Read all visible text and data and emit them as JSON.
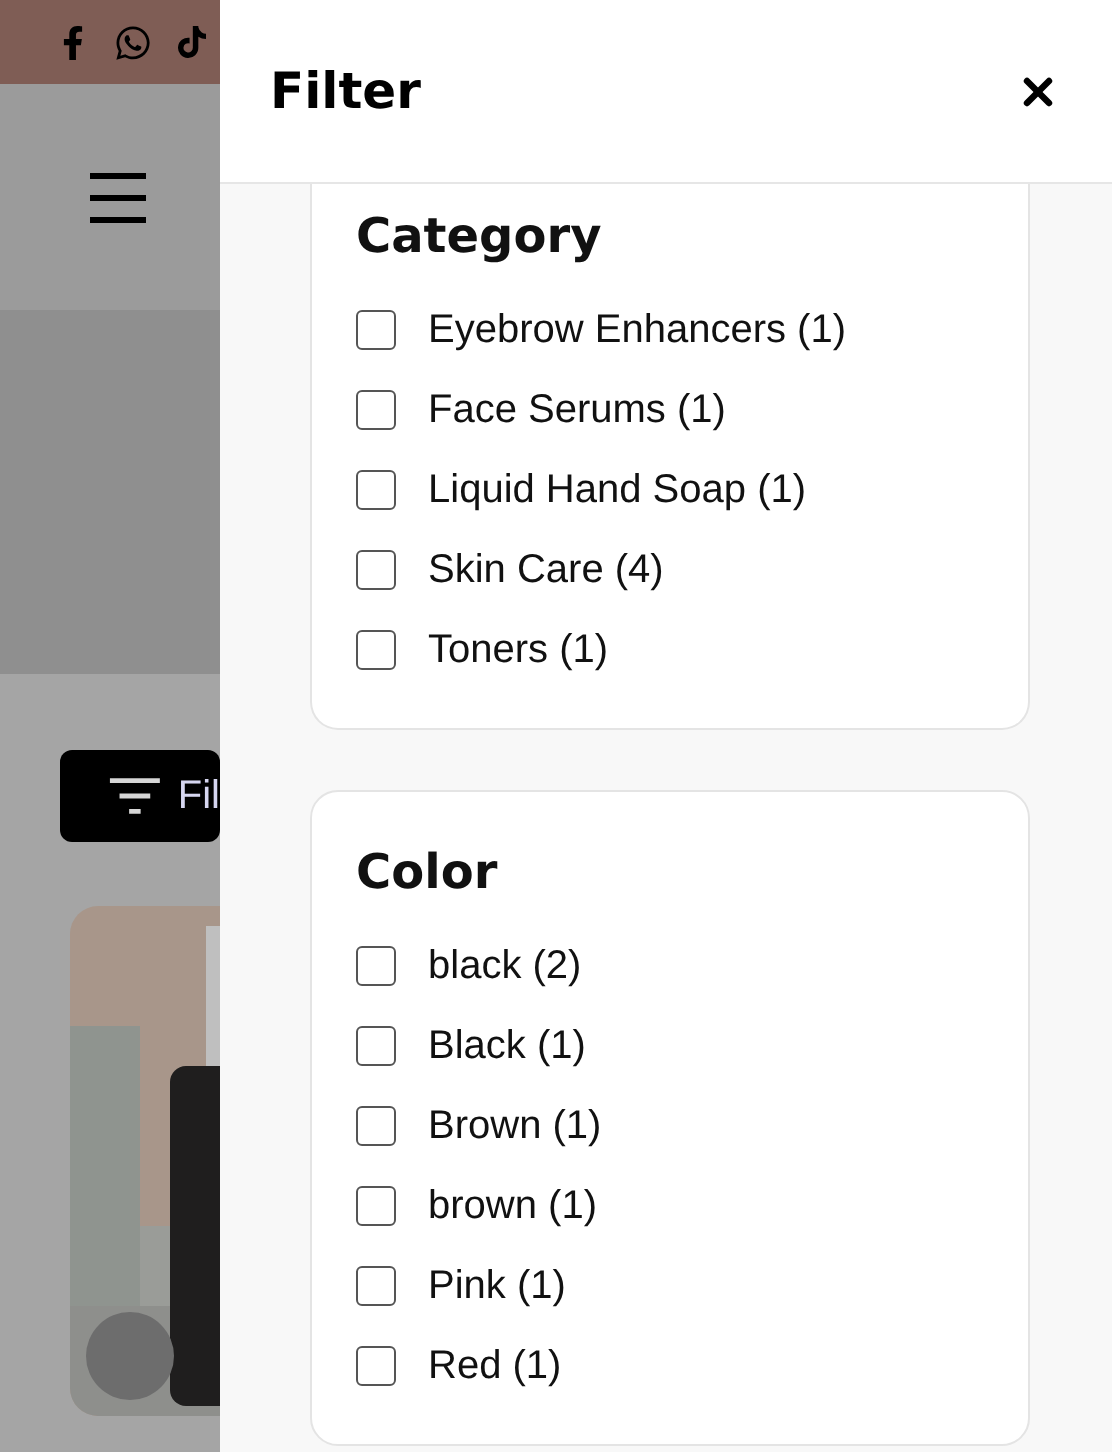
{
  "page": {
    "filter_button": {
      "label": "Fil"
    }
  },
  "drawer": {
    "title": "Filter",
    "sections": [
      {
        "title": "Category",
        "options": [
          {
            "label": "Eyebrow Enhancers (1)",
            "checked": false
          },
          {
            "label": "Face Serums (1)",
            "checked": false
          },
          {
            "label": "Liquid Hand Soap (1)",
            "checked": false
          },
          {
            "label": "Skin Care (4)",
            "checked": false
          },
          {
            "label": "Toners (1)",
            "checked": false
          }
        ]
      },
      {
        "title": "Color",
        "options": [
          {
            "label": "black (2)",
            "checked": false
          },
          {
            "label": "Black (1)",
            "checked": false
          },
          {
            "label": "Brown (1)",
            "checked": false
          },
          {
            "label": "brown (1)",
            "checked": false
          },
          {
            "label": "Pink (1)",
            "checked": false
          },
          {
            "label": "Red (1)",
            "checked": false
          }
        ]
      }
    ]
  }
}
